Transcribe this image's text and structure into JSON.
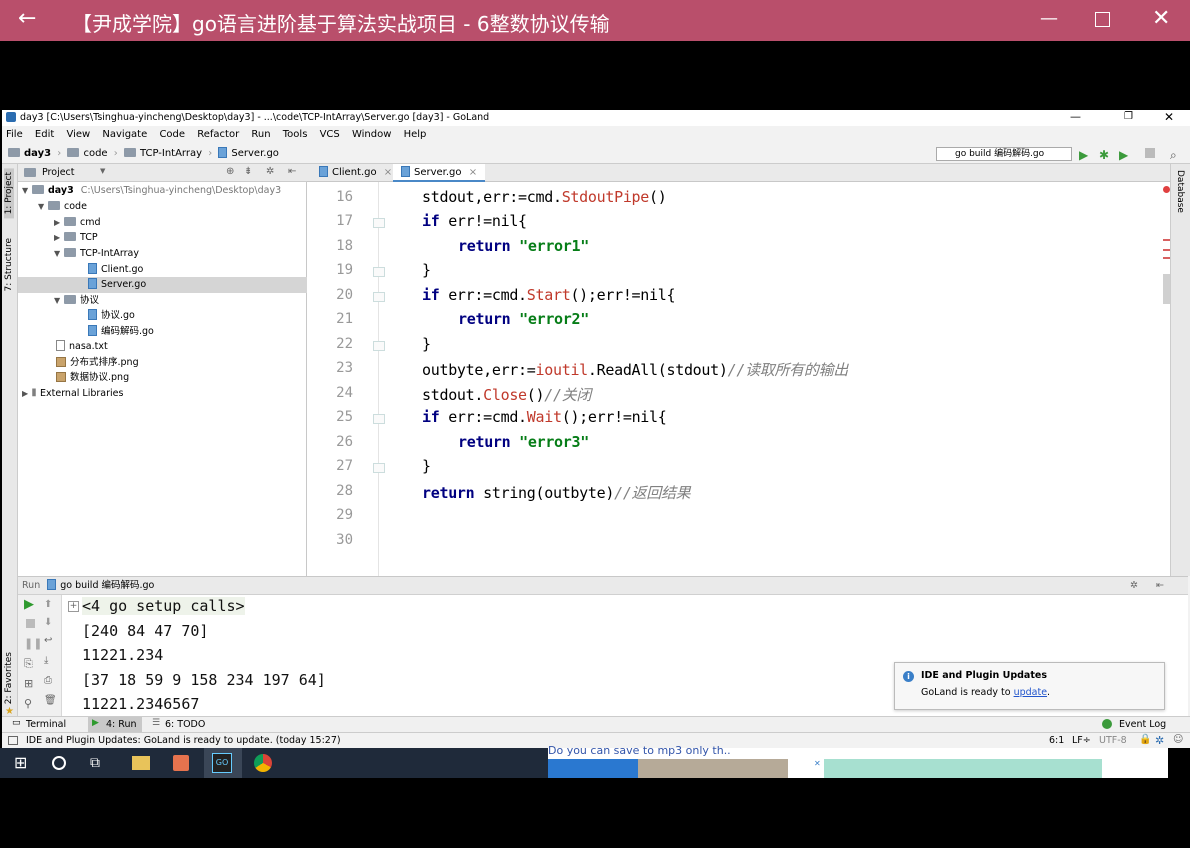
{
  "player": {
    "title": "【尹成学院】go语言进阶基于算法实战项目 - 6整数协议传输"
  },
  "ide": {
    "window_title": "day3 [C:\\Users\\Tsinghua-yincheng\\Desktop\\day3] - ...\\code\\TCP-IntArray\\Server.go [day3] - GoLand",
    "menu": [
      "File",
      "Edit",
      "View",
      "Navigate",
      "Code",
      "Refactor",
      "Run",
      "Tools",
      "VCS",
      "Window",
      "Help"
    ],
    "breadcrumb": [
      "day3",
      "code",
      "TCP-IntArray",
      "Server.go"
    ],
    "run_config": "go build 编码解码.go",
    "left_strip": [
      "1: Project",
      "7: Structure",
      "2: Favorites"
    ],
    "right_strip": "Database",
    "project_panel_title": "Project",
    "tree": {
      "root": "day3",
      "root_path": "C:\\Users\\Tsinghua-yincheng\\Desktop\\day3",
      "code": "code",
      "cmd": "cmd",
      "tcp": "TCP",
      "tcp_intarray": "TCP-IntArray",
      "client": "Client.go",
      "server": "Server.go",
      "xieyi_dir": "协议",
      "xieyi_go": "协议.go",
      "codec_go": "编码解码.go",
      "nasa": "nasa.txt",
      "distsort": "分布式排序.png",
      "dataproto": "数据协议.png",
      "extlib": "External Libraries"
    },
    "tabs": [
      "Client.go",
      "Server.go"
    ],
    "line_numbers": [
      "16",
      "17",
      "18",
      "19",
      "20",
      "21",
      "22",
      "23",
      "24",
      "25",
      "26",
      "27",
      "28",
      "29",
      "30"
    ],
    "code": {
      "l16a": "stdout,err:=cmd.",
      "l16b": "StdoutPipe",
      "l16c": "()",
      "l17a": "if",
      "l17b": " err!=nil{",
      "l18a": "return",
      "l18b": " \"error1\"",
      "l19": "}",
      "l20a": "if",
      "l20b": " err:=cmd.",
      "l20c": "Start",
      "l20d": "();err!=nil{",
      "l21a": "return",
      "l21b": " \"error2\"",
      "l22": "}",
      "l23a": "outbyte,err:=",
      "l23b": "ioutil",
      "l23c": ".ReadAll(stdout)",
      "l23d": "//读取所有的输出",
      "l24a": "stdout.",
      "l24b": "Close",
      "l24c": "()",
      "l24d": "//关闭",
      "l25a": "if",
      "l25b": " err:=cmd.",
      "l25c": "Wait",
      "l25d": "();err!=nil{",
      "l26a": "return",
      "l26b": " \"error3\"",
      "l27": "}",
      "l28a": "return",
      "l28b": " string(outbyte)",
      "l28c": "//返回结果"
    },
    "run": {
      "label": "Run",
      "config": "go build 编码解码.go",
      "output": [
        "<4 go setup calls>",
        "[240 84 47 70]",
        "11221.234",
        "[37 18 59 9 158 234 197 64]",
        "11221.2346567"
      ]
    },
    "notification": {
      "title": "IDE and Plugin Updates",
      "text": "GoLand is ready to ",
      "link": "update",
      "end": "."
    },
    "bottom_tabs": {
      "terminal": "Terminal",
      "run": "4: Run",
      "todo": "6: TODO",
      "event_log": "Event Log"
    },
    "status": {
      "message": "IDE and Plugin Updates: GoLand is ready to update. (today 15:27)",
      "position": "6:1",
      "line_sep": "LF÷",
      "encoding": "UTF-8"
    }
  },
  "ad": {
    "text": "Do you can save to mp3 only th.."
  }
}
